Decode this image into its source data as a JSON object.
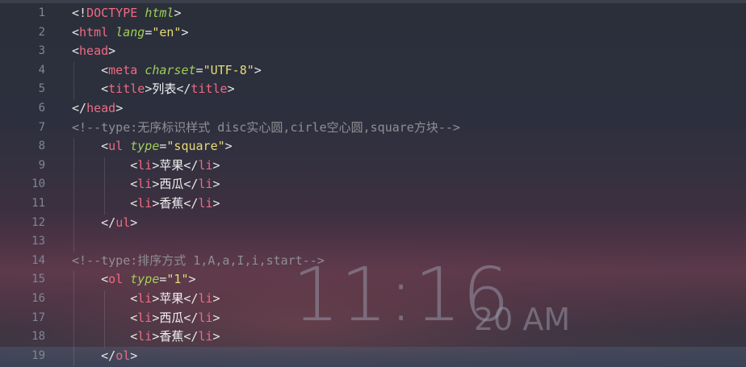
{
  "lines": [
    {
      "n": "1",
      "parts": [
        [
          "punct",
          "<!"
        ],
        [
          "tag",
          "DOCTYPE"
        ],
        [
          "punct",
          " "
        ],
        [
          "attr",
          "html"
        ],
        [
          "punct",
          ">"
        ]
      ]
    },
    {
      "n": "2",
      "parts": [
        [
          "punct",
          "<"
        ],
        [
          "tag",
          "html"
        ],
        [
          "punct",
          " "
        ],
        [
          "attr",
          "lang"
        ],
        [
          "punct",
          "="
        ],
        [
          "str",
          "\"en\""
        ],
        [
          "punct",
          ">"
        ]
      ]
    },
    {
      "n": "3",
      "parts": [
        [
          "punct",
          "<"
        ],
        [
          "tag",
          "head"
        ],
        [
          "punct",
          ">"
        ]
      ]
    },
    {
      "n": "4",
      "parts": [
        [
          "punct",
          "    <"
        ],
        [
          "tag",
          "meta"
        ],
        [
          "punct",
          " "
        ],
        [
          "attr",
          "charset"
        ],
        [
          "punct",
          "="
        ],
        [
          "str",
          "\"UTF-8\""
        ],
        [
          "punct",
          ">"
        ]
      ]
    },
    {
      "n": "5",
      "parts": [
        [
          "punct",
          "    <"
        ],
        [
          "tag",
          "title"
        ],
        [
          "punct",
          ">"
        ],
        [
          "text",
          "列表"
        ],
        [
          "punct",
          "</"
        ],
        [
          "tag",
          "title"
        ],
        [
          "punct",
          ">"
        ]
      ]
    },
    {
      "n": "6",
      "parts": [
        [
          "punct",
          "</"
        ],
        [
          "tag",
          "head"
        ],
        [
          "punct",
          ">"
        ]
      ]
    },
    {
      "n": "7",
      "parts": [
        [
          "comment",
          "<!--type:无序标识样式 disc实心圆,cirle空心圆,square方块-->"
        ]
      ]
    },
    {
      "n": "8",
      "parts": [
        [
          "punct",
          "    <"
        ],
        [
          "tag",
          "ul"
        ],
        [
          "punct",
          " "
        ],
        [
          "attr",
          "type"
        ],
        [
          "punct",
          "="
        ],
        [
          "str",
          "\"square\""
        ],
        [
          "punct",
          ">"
        ]
      ]
    },
    {
      "n": "9",
      "parts": [
        [
          "punct",
          "        <"
        ],
        [
          "tag",
          "li"
        ],
        [
          "punct",
          ">"
        ],
        [
          "text",
          "苹果"
        ],
        [
          "punct",
          "</"
        ],
        [
          "tag",
          "li"
        ],
        [
          "punct",
          ">"
        ]
      ]
    },
    {
      "n": "10",
      "parts": [
        [
          "punct",
          "        <"
        ],
        [
          "tag",
          "li"
        ],
        [
          "punct",
          ">"
        ],
        [
          "text",
          "西瓜"
        ],
        [
          "punct",
          "</"
        ],
        [
          "tag",
          "li"
        ],
        [
          "punct",
          ">"
        ]
      ]
    },
    {
      "n": "11",
      "parts": [
        [
          "punct",
          "        <"
        ],
        [
          "tag",
          "li"
        ],
        [
          "punct",
          ">"
        ],
        [
          "text",
          "香蕉"
        ],
        [
          "punct",
          "</"
        ],
        [
          "tag",
          "li"
        ],
        [
          "punct",
          ">"
        ]
      ]
    },
    {
      "n": "12",
      "parts": [
        [
          "punct",
          "    </"
        ],
        [
          "tag",
          "ul"
        ],
        [
          "punct",
          ">"
        ]
      ]
    },
    {
      "n": "13",
      "parts": []
    },
    {
      "n": "14",
      "parts": [
        [
          "comment",
          "<!--type:排序方式 1,A,a,I,i,start-->"
        ]
      ]
    },
    {
      "n": "15",
      "parts": [
        [
          "punct",
          "    <"
        ],
        [
          "tag",
          "ol"
        ],
        [
          "punct",
          " "
        ],
        [
          "attr",
          "type"
        ],
        [
          "punct",
          "="
        ],
        [
          "str",
          "\"1\""
        ],
        [
          "punct",
          ">"
        ]
      ]
    },
    {
      "n": "16",
      "parts": [
        [
          "punct",
          "        <"
        ],
        [
          "tag",
          "li"
        ],
        [
          "punct",
          ">"
        ],
        [
          "text",
          "苹果"
        ],
        [
          "punct",
          "</"
        ],
        [
          "tag",
          "li"
        ],
        [
          "punct",
          ">"
        ]
      ]
    },
    {
      "n": "17",
      "parts": [
        [
          "punct",
          "        <"
        ],
        [
          "tag",
          "li"
        ],
        [
          "punct",
          ">"
        ],
        [
          "text",
          "西瓜"
        ],
        [
          "punct",
          "</"
        ],
        [
          "tag",
          "li"
        ],
        [
          "punct",
          ">"
        ]
      ]
    },
    {
      "n": "18",
      "parts": [
        [
          "punct",
          "        <"
        ],
        [
          "tag",
          "li"
        ],
        [
          "punct",
          ">"
        ],
        [
          "text",
          "香蕉"
        ],
        [
          "punct",
          "</"
        ],
        [
          "tag",
          "li"
        ],
        [
          "punct",
          ">"
        ]
      ]
    },
    {
      "n": "19",
      "parts": [
        [
          "punct",
          "    </"
        ],
        [
          "tag",
          "ol"
        ],
        [
          "punct",
          ">"
        ]
      ]
    }
  ],
  "clock": {
    "time": "11:16",
    "suffix": "20 AM"
  },
  "colors": {
    "tag": "#ef6b82",
    "attr": "#9ece58",
    "string": "#e6db74",
    "comment": "#8e8f94",
    "line_number": "#7f8794"
  }
}
